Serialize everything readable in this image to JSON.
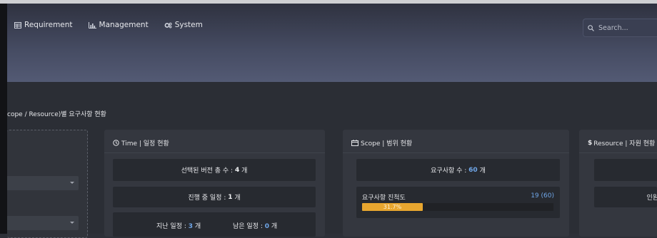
{
  "nav": {
    "items": [
      {
        "label": "Requirement",
        "icon": "table-icon"
      },
      {
        "label": "Management",
        "icon": "chart-icon"
      },
      {
        "label": "System",
        "icon": "gear-icon"
      }
    ]
  },
  "search": {
    "placeholder": "Search..."
  },
  "section": {
    "title": "cope / Resource)별 요구사항 현황"
  },
  "time_panel": {
    "title": "Time | 일정 현황",
    "selected_version_label": "선택된 버전 총 수 :",
    "selected_version_value": "4",
    "selected_version_unit": "개",
    "in_progress_label": "진행 중 일정 :",
    "in_progress_value": "1",
    "in_progress_unit": "개",
    "past_label": "지난 일정 :",
    "past_value": "3",
    "past_unit": "개",
    "remaining_label": "남은 일정 :",
    "remaining_value": "0",
    "remaining_unit": "개"
  },
  "scope_panel": {
    "title": "Scope | 범위 현황",
    "req_count_label": "요구사항 수 :",
    "req_count_value": "60",
    "req_count_unit": "개",
    "progress_label": "요구사항 진척도",
    "progress_count": "19 (60)",
    "progress_percent_text": "31.7%",
    "progress_fraction": 0.317
  },
  "resource_panel": {
    "title": "Resource | 자원 현황",
    "partial_text": "인원"
  },
  "colors": {
    "accent_blue": "#6fa6e8",
    "progress_orange": "#e8a62f",
    "header_gradient_end": "#535a74"
  }
}
